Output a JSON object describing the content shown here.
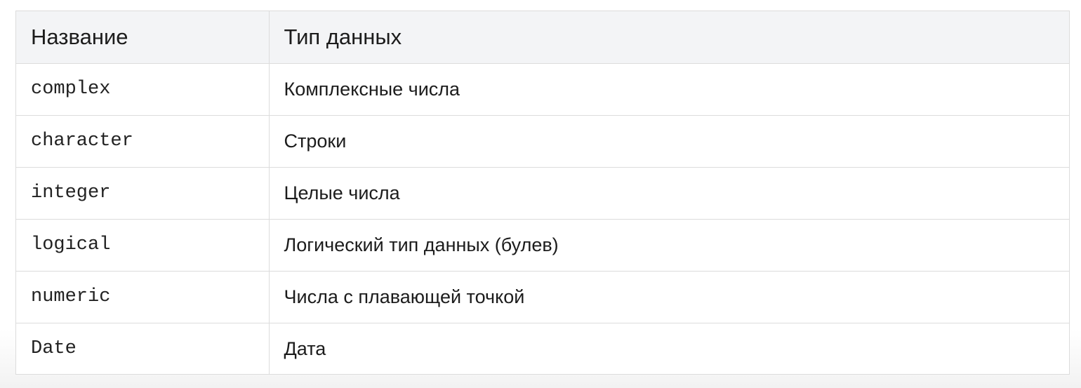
{
  "table": {
    "headers": {
      "name": "Название",
      "type": "Тип данных"
    },
    "rows": [
      {
        "name": "complex",
        "type": "Комплексные числа"
      },
      {
        "name": "character",
        "type": "Строки"
      },
      {
        "name": "integer",
        "type": "Целые числа"
      },
      {
        "name": "logical",
        "type": "Логический тип данных (булев)"
      },
      {
        "name": "numeric",
        "type": "Числа с плавающей точкой"
      },
      {
        "name": "Date",
        "type": "Дата"
      }
    ]
  }
}
